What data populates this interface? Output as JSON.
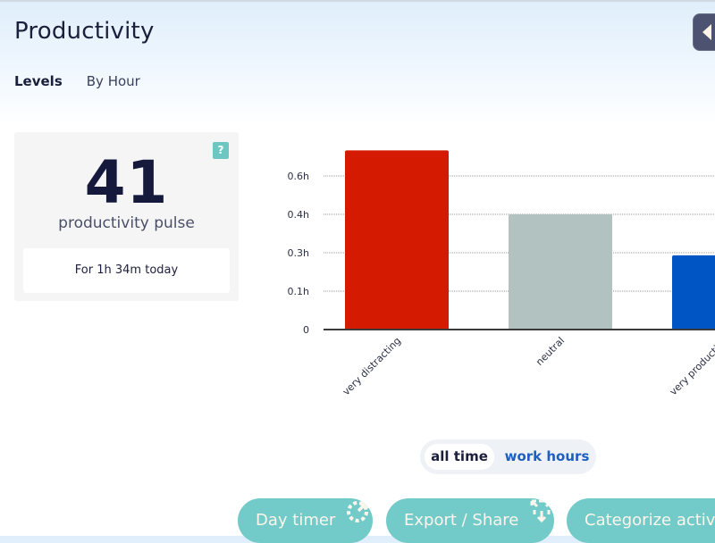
{
  "header": {
    "title": "Productivity",
    "collapse_icon": "chevron-left-icon"
  },
  "tabs": [
    {
      "label": "Levels",
      "active": true
    },
    {
      "label": "By Hour",
      "active": false
    }
  ],
  "pulse": {
    "value": "41",
    "label": "productivity pulse",
    "subtitle": "For 1h 34m today",
    "help_label": "?"
  },
  "toggle": {
    "options": [
      {
        "label": "all time",
        "selected": true
      },
      {
        "label": "work hours",
        "selected": false
      }
    ]
  },
  "actions": [
    {
      "label": "Day timer",
      "icon": "timer-refresh-icon"
    },
    {
      "label": "Export / Share",
      "icon": "export-share-icon"
    },
    {
      "label": "Categorize activiti",
      "icon": ""
    }
  ],
  "colors": {
    "very_distracting": "#d41a00",
    "neutral": "#b1c2c0",
    "very_productive": "#0055c4",
    "accent": "#72cbc8",
    "link": "#1e5fc0"
  },
  "chart_data": {
    "type": "bar",
    "title": "",
    "xlabel": "",
    "ylabel": "",
    "categories": [
      "very distracting",
      "neutral",
      "very productive"
    ],
    "values": [
      0.7,
      0.45,
      0.29
    ],
    "bar_colors": [
      "#d41a00",
      "#b1c2c0",
      "#0055c4"
    ],
    "units": "hours",
    "yticks": [
      0,
      0.15,
      0.3,
      0.45,
      0.6
    ],
    "ytick_labels": [
      "0",
      "0.1h",
      "0.3h",
      "0.4h",
      "0.6h"
    ],
    "ylim": [
      0,
      0.75
    ],
    "grid": true
  }
}
